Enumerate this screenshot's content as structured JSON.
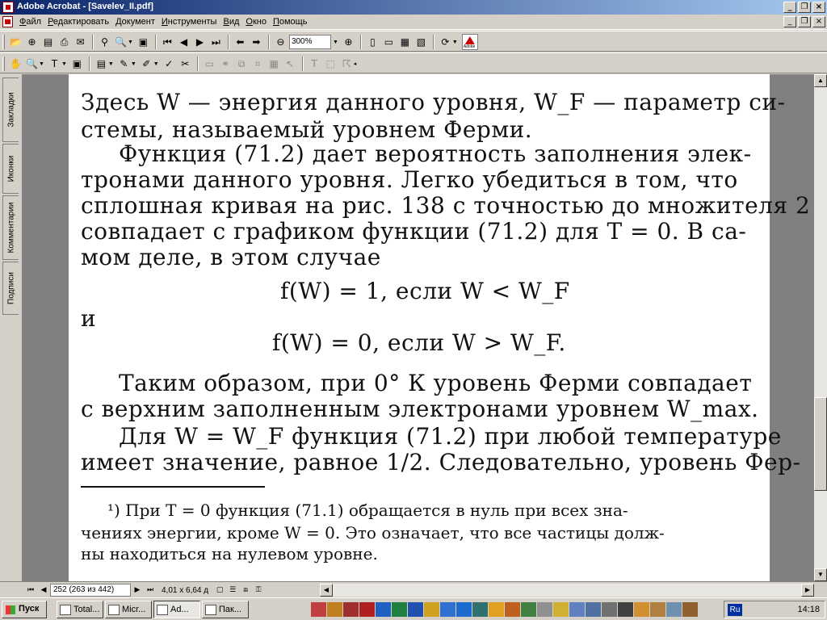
{
  "window": {
    "title": "Adobe Acrobat - [Savelev_II.pdf]",
    "controls": [
      "_",
      "❐",
      "×"
    ]
  },
  "menu": [
    "Файл",
    "Редактировать",
    "Документ",
    "Инструменты",
    "Вид",
    "Окно",
    "Помощь"
  ],
  "toolbar": {
    "zoom": "300%"
  },
  "side_tabs": [
    "Закладки",
    "Иконки",
    "Комментарии",
    "Подписи"
  ],
  "document": {
    "lines": [
      "Здесь W — энергия данного уровня, W_F — параметр си-",
      "стемы, называемый уровнем Ферми.",
      "Функция (71.2) дает вероятность заполнения элек-",
      "тронами данного уровня. Легко убедиться в том, что",
      "сплошная кривая на рис. 138 с точностью до множителя 2",
      "совпадает с графиком функции (71.2) для T = 0. В са-",
      "мом деле, в этом случае",
      "f(W) = 1, если W < W_F",
      "и",
      "f(W) = 0, если W > W_F.",
      "Таким образом, при 0° К уровень Ферми совпадает",
      "с верхним заполненным электронами уровнем W_max.",
      "Для W = W_F функция (71.2) при любой температуре",
      "имеет значение, равное 1/2. Следовательно, уровень Фер-"
    ],
    "footnote": [
      "¹) При T = 0 функция (71.1) обращается в нуль при всех зна-",
      "чениях энергии, кроме W = 0. Это означает, что все частицы долж-",
      "ны находиться на нулевом уровне."
    ]
  },
  "status": {
    "page": "252 (263 из 442)",
    "size": "4,01 x 6,64 д"
  },
  "taskbar": {
    "start": "Пуск",
    "buttons": [
      "Total...",
      "Micr...",
      "Ad...",
      "Пак..."
    ],
    "lang": "Ru",
    "clock": "14:18"
  }
}
